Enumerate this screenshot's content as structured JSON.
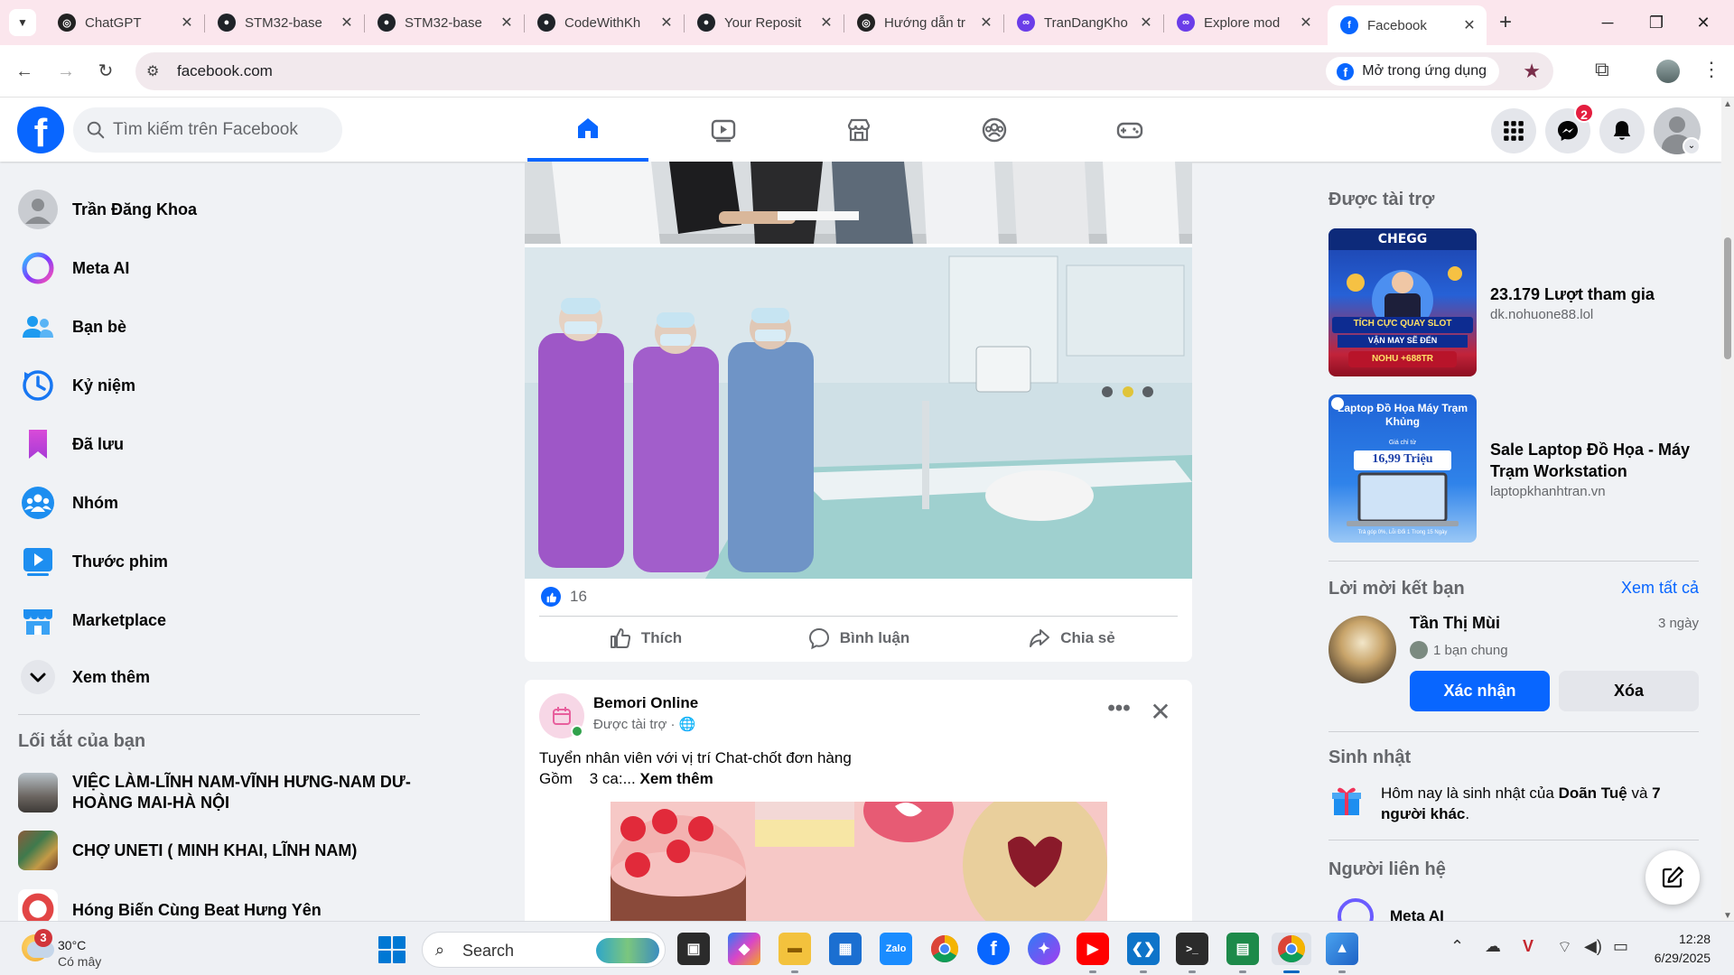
{
  "browser": {
    "tabs": [
      {
        "title": "ChatGPT",
        "icon": "openai-icon",
        "active": false
      },
      {
        "title": "STM32-base",
        "icon": "github-icon",
        "active": false
      },
      {
        "title": "STM32-base",
        "icon": "github-icon",
        "active": false
      },
      {
        "title": "CodeWithKh",
        "icon": "github-icon",
        "active": false
      },
      {
        "title": "Your Reposit",
        "icon": "github-icon",
        "active": false
      },
      {
        "title": "Hướng dẫn tr",
        "icon": "openai-icon",
        "active": false
      },
      {
        "title": "TranDangKho",
        "icon": "copilot-icon",
        "active": false
      },
      {
        "title": "Explore mod",
        "icon": "copilot-icon",
        "active": false
      },
      {
        "title": "Facebook",
        "icon": "facebook-icon",
        "active": true
      }
    ],
    "url": "facebook.com",
    "open_in_app": "Mở trong ứng dụng"
  },
  "header": {
    "search_placeholder": "Tìm kiếm trên Facebook",
    "messenger_badge": "2",
    "nav": [
      "home",
      "video",
      "marketplace",
      "groups",
      "gaming"
    ]
  },
  "sidebar": {
    "items": [
      {
        "label": "Trần Đăng Khoa",
        "icon": "profile-avatar-icon"
      },
      {
        "label": "Meta AI",
        "icon": "meta-ai-icon"
      },
      {
        "label": "Bạn bè",
        "icon": "friends-icon"
      },
      {
        "label": "Kỷ niệm",
        "icon": "memories-clock-icon"
      },
      {
        "label": "Đã lưu",
        "icon": "saved-bookmark-icon"
      },
      {
        "label": "Nhóm",
        "icon": "groups-icon"
      },
      {
        "label": "Thước phim",
        "icon": "reels-icon"
      },
      {
        "label": "Marketplace",
        "icon": "marketplace-icon"
      },
      {
        "label": "Xem thêm",
        "icon": "chevron-down-icon"
      }
    ],
    "shortcuts_title": "Lối tắt của bạn",
    "shortcuts": [
      {
        "label": "VIỆC LÀM-LĨNH NAM-VĨNH HƯNG-NAM DƯ-HOÀNG MAI-HÀ NỘI"
      },
      {
        "label": "CHỢ UNETI ( MINH KHAI, LĨNH NAM)"
      },
      {
        "label": "Hóng Biến Cùng Beat Hưng Yên"
      }
    ]
  },
  "feed": {
    "post1": {
      "reaction_count": "16",
      "actions": [
        "Thích",
        "Bình luận",
        "Chia sẻ"
      ]
    },
    "post2": {
      "author": "Bemori Online",
      "sponsored": "Được tài trợ · ",
      "text_line1": "Tuyển nhân viên với vị trí Chat-chốt đơn hàng",
      "text_line2": "Gồm    3 ca:...",
      "see_more": "Xem thêm"
    }
  },
  "right": {
    "sponsored_title": "Được tài trợ",
    "ads": [
      {
        "title": "23.179 Lượt tham gia",
        "domain": "dk.nohuone88.lol",
        "img_text_top": "CHEGG",
        "img_text_mid": "TÍCH CỰC QUAY SLOT",
        "img_text_sub": "VẬN MAY SẼ ĐẾN",
        "img_text_bot": "NOHU +688TR"
      },
      {
        "title": "Sale Laptop Đồ Họa - Máy Trạm Workstation",
        "domain": "laptopkhanhtran.vn",
        "img_text_top": "Laptop Đồ Họa Máy Trạm Khủng",
        "img_text_small": "Giá chỉ từ",
        "img_price": "16,99 Triệu",
        "img_foot": "Trả góp 0%, Lỗi Đổi 1 Trong 15 Ngày"
      }
    ],
    "friend_requests_title": "Lời mời kết bạn",
    "see_all": "Xem tất cả",
    "request": {
      "name": "Tần Thị Mùi",
      "time": "3 ngày",
      "mutual": "1 bạn chung",
      "confirm": "Xác nhận",
      "delete": "Xóa"
    },
    "birthday_title": "Sinh nhật",
    "birthday_prefix": "Hôm nay là sinh nhật của ",
    "birthday_name": "Doãn Tuệ",
    "birthday_mid": " và ",
    "birthday_others": "7 người khác",
    "birthday_end": ".",
    "contacts_title": "Người liên hệ",
    "contact_first": "Meta AI"
  },
  "taskbar": {
    "weather_badge": "3",
    "temperature": "30°C",
    "condition": "Có mây",
    "search": "Search",
    "time": "12:28",
    "date": "6/29/2025"
  },
  "colors": {
    "fb_blue": "#0866ff",
    "bg": "#f0f2f5",
    "secondary_text": "#65676b"
  }
}
